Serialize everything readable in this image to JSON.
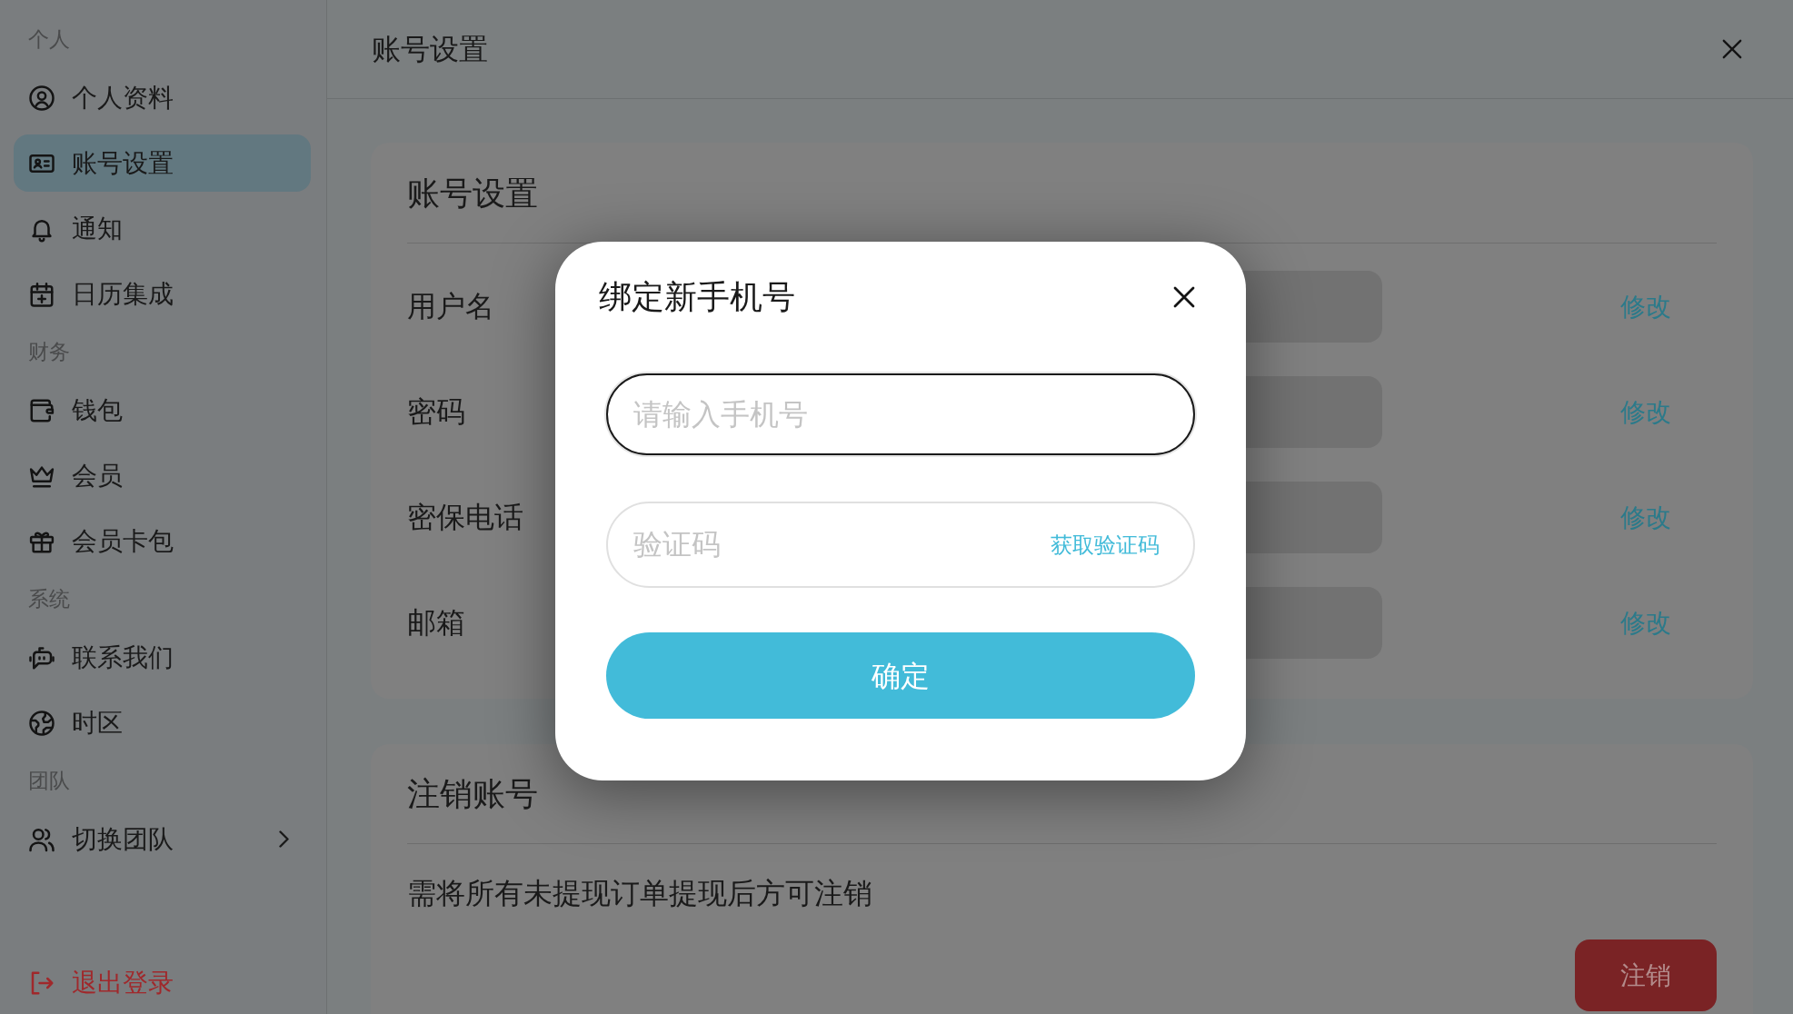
{
  "sidebar": {
    "sections": [
      {
        "title": "个人",
        "items": [
          {
            "label": "个人资料",
            "selected": false,
            "submenu": false
          },
          {
            "label": "账号设置",
            "selected": true,
            "submenu": false
          },
          {
            "label": "通知",
            "selected": false,
            "submenu": false
          },
          {
            "label": "日历集成",
            "selected": false,
            "submenu": false
          }
        ]
      },
      {
        "title": "财务",
        "items": [
          {
            "label": "钱包",
            "selected": false,
            "submenu": false
          },
          {
            "label": "会员",
            "selected": false,
            "submenu": false
          },
          {
            "label": "会员卡包",
            "selected": false,
            "submenu": false
          }
        ]
      },
      {
        "title": "系统",
        "items": [
          {
            "label": "联系我们",
            "selected": false,
            "submenu": false
          },
          {
            "label": "时区",
            "selected": false,
            "submenu": false
          }
        ]
      },
      {
        "title": "团队",
        "items": [
          {
            "label": "切换团队",
            "selected": false,
            "submenu": true
          }
        ]
      }
    ],
    "logout": "退出登录"
  },
  "header": {
    "title": "账号设置"
  },
  "account_card": {
    "title": "账号设置",
    "rows": [
      {
        "label": "用户名",
        "action": "修改"
      },
      {
        "label": "密码",
        "action": "修改"
      },
      {
        "label": "密保电话",
        "action": "修改"
      },
      {
        "label": "邮箱",
        "action": "修改"
      }
    ]
  },
  "delete_card": {
    "title": "注销账号",
    "note": "需将所有未提现订单提现后方可注销",
    "button": "注销"
  },
  "dialog": {
    "title": "绑定新手机号",
    "phone_field": {
      "placeholder": "请输入手机号",
      "focused": true
    },
    "code_field": {
      "placeholder": "验证码",
      "focused": false,
      "action": "获取验证码"
    },
    "confirm_button": "确定"
  }
}
